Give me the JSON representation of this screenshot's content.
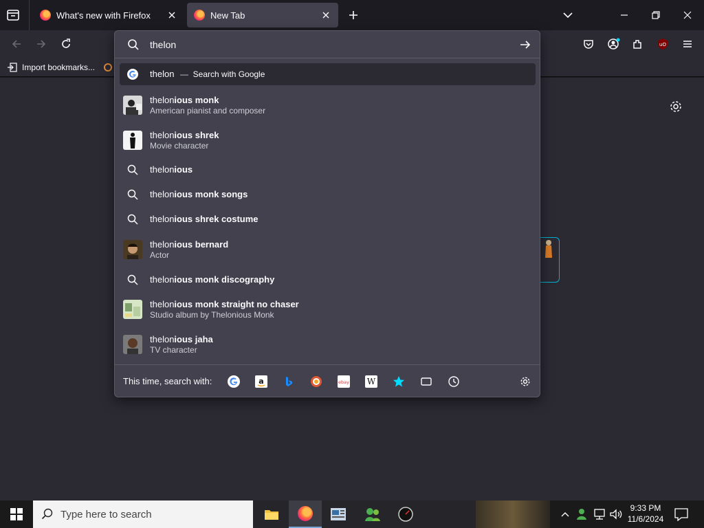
{
  "tabs": [
    {
      "title": "What's new with Firefox"
    },
    {
      "title": "New Tab"
    }
  ],
  "urlbar": {
    "value": "thelon"
  },
  "bookmarks": {
    "import_label": "Import bookmarks..."
  },
  "suggestions": {
    "google": {
      "typed": "thelon",
      "dash": "—",
      "action": "Search with Google"
    },
    "items": [
      {
        "typed": "thelon",
        "rest": "ious monk",
        "sub": "American pianist and composer",
        "icon": "photo-thumbnail"
      },
      {
        "typed": "thelon",
        "rest": "ious shrek",
        "sub": "Movie character",
        "icon": "silhouette-thumbnail"
      },
      {
        "typed": "thelon",
        "rest": "ious",
        "icon": "search-icon"
      },
      {
        "typed": "thelon",
        "rest": "ious monk songs",
        "icon": "search-icon"
      },
      {
        "typed": "thelon",
        "rest": "ious shrek costume",
        "icon": "search-icon"
      },
      {
        "typed": "thelon",
        "rest": "ious bernard",
        "sub": "Actor",
        "icon": "photo-thumbnail"
      },
      {
        "typed": "thelon",
        "rest": "ious monk discography",
        "icon": "search-icon"
      },
      {
        "typed": "thelon",
        "rest": "ious monk straight no chaser",
        "sub": "Studio album by Thelonious Monk",
        "icon": "album-thumbnail"
      },
      {
        "typed": "thelon",
        "rest": "ious jaha",
        "sub": "TV character",
        "icon": "photo-thumbnail"
      }
    ]
  },
  "oneoff": {
    "label": "This time, search with:"
  },
  "taskbar": {
    "search_placeholder": "Type here to search",
    "time": "9:33 PM",
    "date": "11/6/2024"
  },
  "colors": {
    "accent": "#00ddff",
    "panel": "#42414d",
    "toolbar": "#2b2a33",
    "frame": "#1c1b22"
  }
}
